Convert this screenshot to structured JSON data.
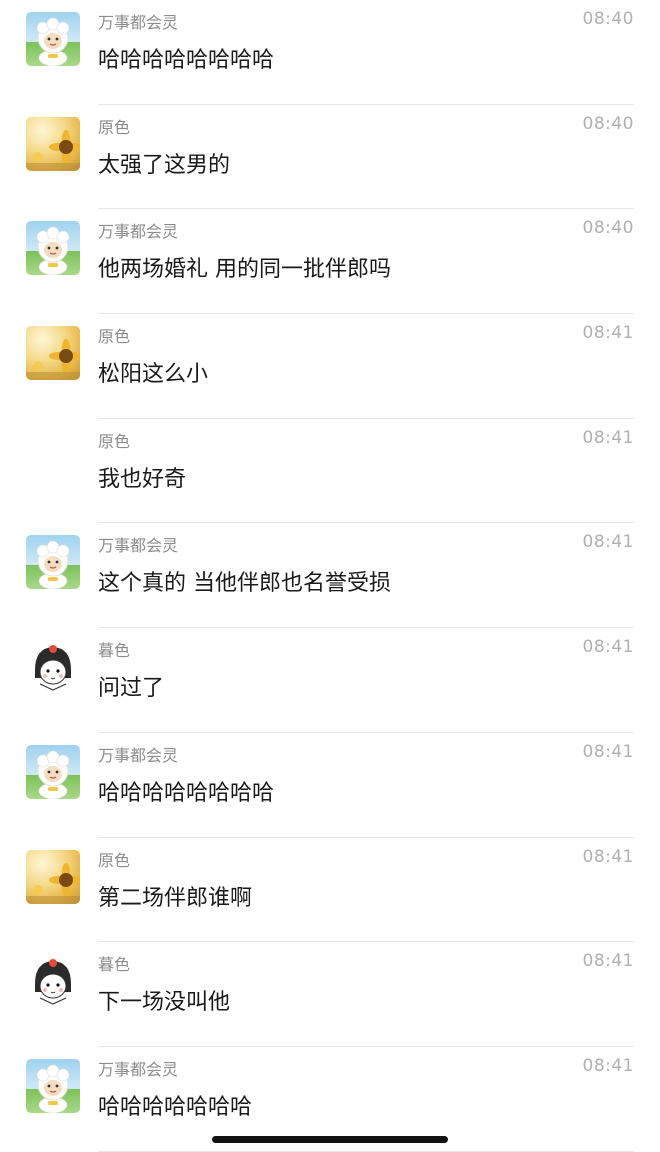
{
  "messages": [
    {
      "sender": "万事都会灵",
      "time": "08:40",
      "text": "哈哈哈哈哈哈哈哈",
      "avatar": "sheep"
    },
    {
      "sender": "原色",
      "time": "08:40",
      "text": "太强了这男的",
      "avatar": "sunflower"
    },
    {
      "sender": "万事都会灵",
      "time": "08:40",
      "text": "他两场婚礼 用的同一批伴郎吗",
      "avatar": "sheep"
    },
    {
      "sender": "原色",
      "time": "08:41",
      "text": "松阳这么小",
      "avatar": "sunflower"
    },
    {
      "sender": "原色",
      "time": "08:41",
      "text": "我也好奇",
      "avatar": "none"
    },
    {
      "sender": "万事都会灵",
      "time": "08:41",
      "text": "这个真的 当他伴郎也名誉受损",
      "avatar": "sheep"
    },
    {
      "sender": "暮色",
      "time": "08:41",
      "text": "问过了",
      "avatar": "girl"
    },
    {
      "sender": "万事都会灵",
      "time": "08:41",
      "text": "哈哈哈哈哈哈哈哈",
      "avatar": "sheep"
    },
    {
      "sender": "原色",
      "time": "08:41",
      "text": "第二场伴郎谁啊",
      "avatar": "sunflower"
    },
    {
      "sender": "暮色",
      "time": "08:41",
      "text": "下一场没叫他",
      "avatar": "girl"
    },
    {
      "sender": "万事都会灵",
      "time": "08:41",
      "text": "哈哈哈哈哈哈哈",
      "avatar": "sheep"
    }
  ]
}
